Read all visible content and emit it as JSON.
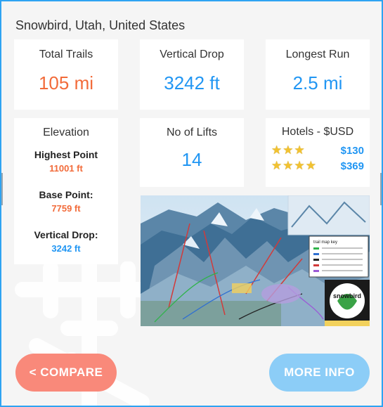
{
  "location": "Snowbird, Utah, United States",
  "stats": {
    "total_trails": {
      "label": "Total Trails",
      "value": "105 mi"
    },
    "vertical_drop": {
      "label": "Vertical Drop",
      "value": "3242 ft"
    },
    "longest_run": {
      "label": "Longest Run",
      "value": "2.5 mi"
    },
    "lifts": {
      "label": "No of Lifts",
      "value": "14"
    }
  },
  "elevation": {
    "title": "Elevation",
    "highest_label": "Highest Point",
    "highest_value": "11001 ft",
    "base_label": "Base Point:",
    "base_value": "7759 ft",
    "drop_label": "Vertical Drop:",
    "drop_value": "3242 ft"
  },
  "hotels": {
    "title": "Hotels - $USD",
    "items": [
      {
        "stars": "★★★",
        "rating": 3,
        "price": "$130"
      },
      {
        "stars": "★★★★",
        "rating": 4,
        "price": "$369"
      }
    ]
  },
  "map": {
    "logo_text": "snowbird",
    "key_title": "trail map key"
  },
  "buttons": {
    "compare": "< COMPARE",
    "more_info": "MORE INFO"
  },
  "colors": {
    "accent_blue": "#2196f3",
    "accent_orange": "#f26b3a",
    "compare_button": "#f9897a",
    "more_info_button": "#8ccdf7",
    "border": "#2ea3f2"
  },
  "icons": [
    "snowflake-watermark-icon",
    "star-icon"
  ]
}
